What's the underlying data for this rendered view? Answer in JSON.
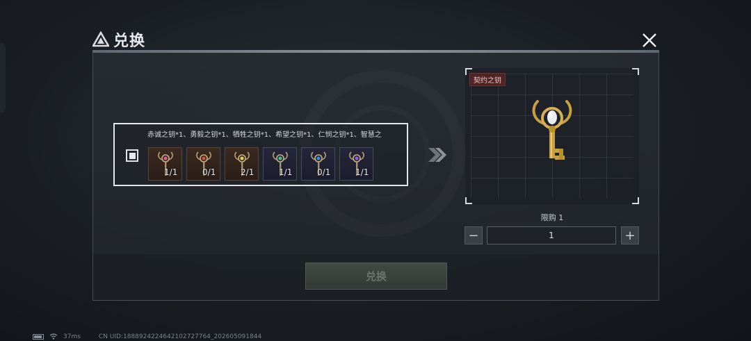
{
  "dialog": {
    "title": "兑换",
    "close_icon": "close-icon"
  },
  "cost": {
    "description": "赤诚之钥*1、勇毅之钥*1、牺牲之钥*1、希望之钥*1、仁悯之钥*1、智慧之",
    "items": [
      {
        "icon": "key-pink-icon",
        "owned": "1",
        "required": "1",
        "frame": "gold",
        "gem_color": "#e05a9a"
      },
      {
        "icon": "key-red-icon",
        "owned": "0",
        "required": "1",
        "frame": "gold",
        "gem_color": "#d64848"
      },
      {
        "icon": "key-yellow-icon",
        "owned": "2",
        "required": "1",
        "frame": "gold",
        "gem_color": "#e0d048"
      },
      {
        "icon": "key-green-icon",
        "owned": "1",
        "required": "1",
        "frame": "purple",
        "gem_color": "#3fbf8a"
      },
      {
        "icon": "key-blue-icon",
        "owned": "0",
        "required": "1",
        "frame": "purple",
        "gem_color": "#3f88d8"
      },
      {
        "icon": "key-violet-icon",
        "owned": "1",
        "required": "1",
        "frame": "purple",
        "gem_color": "#9a5ad8"
      }
    ]
  },
  "reward": {
    "tag": "契约之钥",
    "icon": "contract-key-icon"
  },
  "purchase": {
    "limit_label": "限购 1",
    "quantity": "1",
    "minus_label": "−",
    "plus_label": "+"
  },
  "exchange_button": {
    "label": "兑换"
  },
  "status": {
    "ping": "37ms",
    "uid": "CN UID:1888924224642102727764_202605091844"
  },
  "colors": {
    "accent_gold": "#c8a040",
    "tag_red": "#4f2424"
  }
}
